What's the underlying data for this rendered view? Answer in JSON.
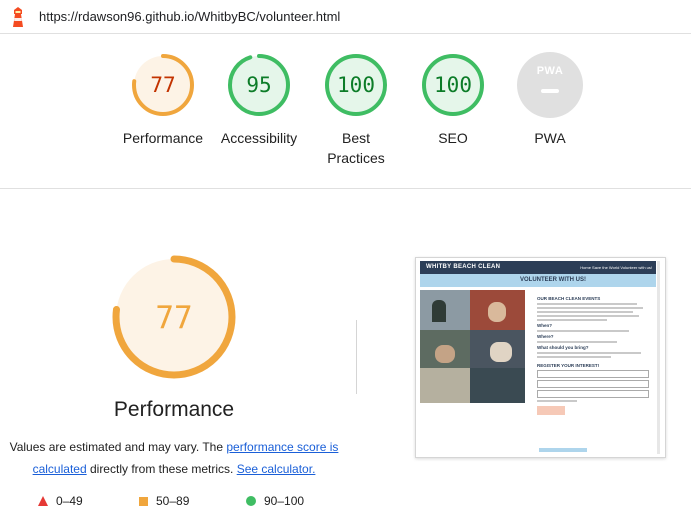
{
  "browser": {
    "url": "https://rdawson96.github.io/WhitbyBC/volunteer.html"
  },
  "colors": {
    "pass": "#0c7c28",
    "pass_ring": "#3fbd63",
    "pass_bg": "#e5f6ea",
    "average": "#c33300",
    "average_ring": "#f0a63d",
    "average_bg": "#fdf3e6",
    "fail": "#e53935",
    "na": "#e0e0e0"
  },
  "categories": [
    {
      "name": "Performance",
      "score": 77,
      "rating": "average"
    },
    {
      "name": "Accessibility",
      "score": 95,
      "rating": "pass"
    },
    {
      "name": "Best Practices",
      "score": 100,
      "rating": "pass"
    },
    {
      "name": "SEO",
      "score": 100,
      "rating": "pass"
    },
    {
      "name": "PWA",
      "badge": "PWA",
      "rating": "na"
    }
  ],
  "performance": {
    "title": "Performance",
    "score": 77,
    "desc_prefix": "Values are estimated and may vary. The ",
    "score_link": "performance score is calculated",
    "desc_mid": " directly from these metrics. ",
    "calc_link": "See calculator."
  },
  "legend": [
    {
      "shape": "triangle",
      "range": "0–49"
    },
    {
      "shape": "square",
      "range": "50–89"
    },
    {
      "shape": "circle",
      "range": "90–100"
    }
  ],
  "screenshot": {
    "brand": "WHITBY BEACH CLEAN",
    "nav": "Home   Save the World   Volunteer with us!",
    "hero": "VOLUNTEER WITH US!",
    "h1": "OUR BEACH CLEAN EVENTS",
    "h2": "When?",
    "h3": "Where?",
    "h4": "What should you bring?",
    "h5": "REGISTER YOUR INTEREST!"
  }
}
